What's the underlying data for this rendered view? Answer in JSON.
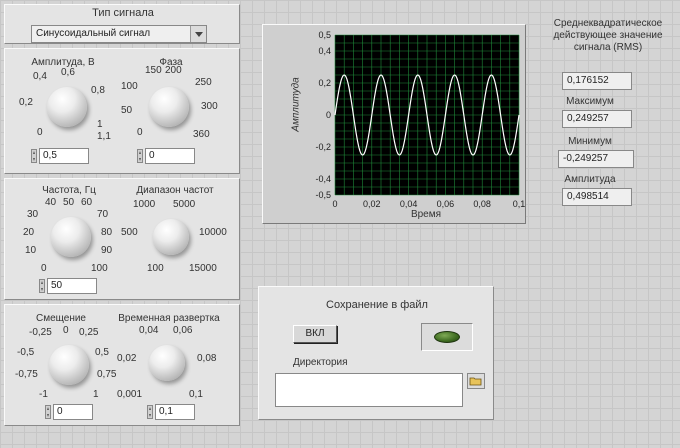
{
  "signal_type": {
    "title": "Тип сигнала",
    "selected": "Синусоидальный сигнал"
  },
  "amplitude": {
    "label": "Амплитуда, В",
    "ticks": [
      "0",
      "0,2",
      "0,4",
      "0,6",
      "0,8",
      "1",
      "1,1"
    ],
    "value": "0,5"
  },
  "phase": {
    "label": "Фаза",
    "ticks": [
      "0",
      "50",
      "100",
      "150",
      "200",
      "250",
      "300",
      "360"
    ],
    "value": "0"
  },
  "frequency": {
    "label": "Частота, Гц",
    "ticks": [
      "0",
      "10",
      "20",
      "30",
      "40",
      "50",
      "60",
      "70",
      "80",
      "90",
      "100"
    ],
    "value": "50"
  },
  "freq_range": {
    "label": "Диапазон частот",
    "ticks": [
      "100",
      "500",
      "1000",
      "5000",
      "10000",
      "15000"
    ]
  },
  "offset": {
    "label": "Смещение",
    "ticks": [
      "-1",
      "-0,75",
      "-0,5",
      "-0,25",
      "0",
      "0,25",
      "0,5",
      "0,75",
      "1"
    ],
    "value": "0"
  },
  "time_sweep": {
    "label": "Временная развертка",
    "ticks": [
      "0,001",
      "0,02",
      "0,04",
      "0,06",
      "0,08",
      "0,1"
    ],
    "value": "0,1"
  },
  "graph": {
    "xlabel": "Время",
    "ylabel": "Амплитуда",
    "xticks": [
      "0",
      "0,02",
      "0,04",
      "0,06",
      "0,08",
      "0,1"
    ],
    "yticks": [
      "0,5",
      "0,4",
      "0,2",
      "0",
      "-0,2",
      "-0,4",
      "-0,5"
    ],
    "background": "#000000",
    "trace_color": "#ffffff",
    "grid_color": "#1f8a3a"
  },
  "chart_data": {
    "type": "line",
    "title": "",
    "xlabel": "Время",
    "ylabel": "Амплитуда",
    "xlim": [
      0,
      0.1
    ],
    "ylim": [
      -0.5,
      0.5
    ],
    "grid": true,
    "series": [
      {
        "function": "0.25*sin(2*pi*50*t)",
        "amplitude": 0.25,
        "frequency_hz": 50,
        "x": [
          0,
          0.005,
          0.01,
          0.015,
          0.02,
          0.025,
          0.03,
          0.035,
          0.04,
          0.045,
          0.05,
          0.055,
          0.06,
          0.065,
          0.07,
          0.075,
          0.08,
          0.085,
          0.09,
          0.095,
          0.1
        ],
        "values": [
          0,
          0.25,
          0,
          -0.25,
          0,
          0.25,
          0,
          -0.25,
          0,
          0.25,
          0,
          -0.25,
          0,
          0.25,
          0,
          -0.25,
          0,
          0.25,
          0,
          -0.25,
          0
        ]
      }
    ]
  },
  "results": {
    "rms_label": "Среднеквадратическое действующее значение сигнала (RMS)",
    "rms_value": "0,176152",
    "max_label": "Максимум",
    "max_value": "0,249257",
    "min_label": "Минимум",
    "min_value": "-0,249257",
    "amp_label": "Амплитуда",
    "amp_value": "0,498514"
  },
  "save": {
    "title": "Сохранение в файл",
    "toggle_label": "ВКЛ",
    "dir_label": "Директория",
    "path_value": ""
  }
}
